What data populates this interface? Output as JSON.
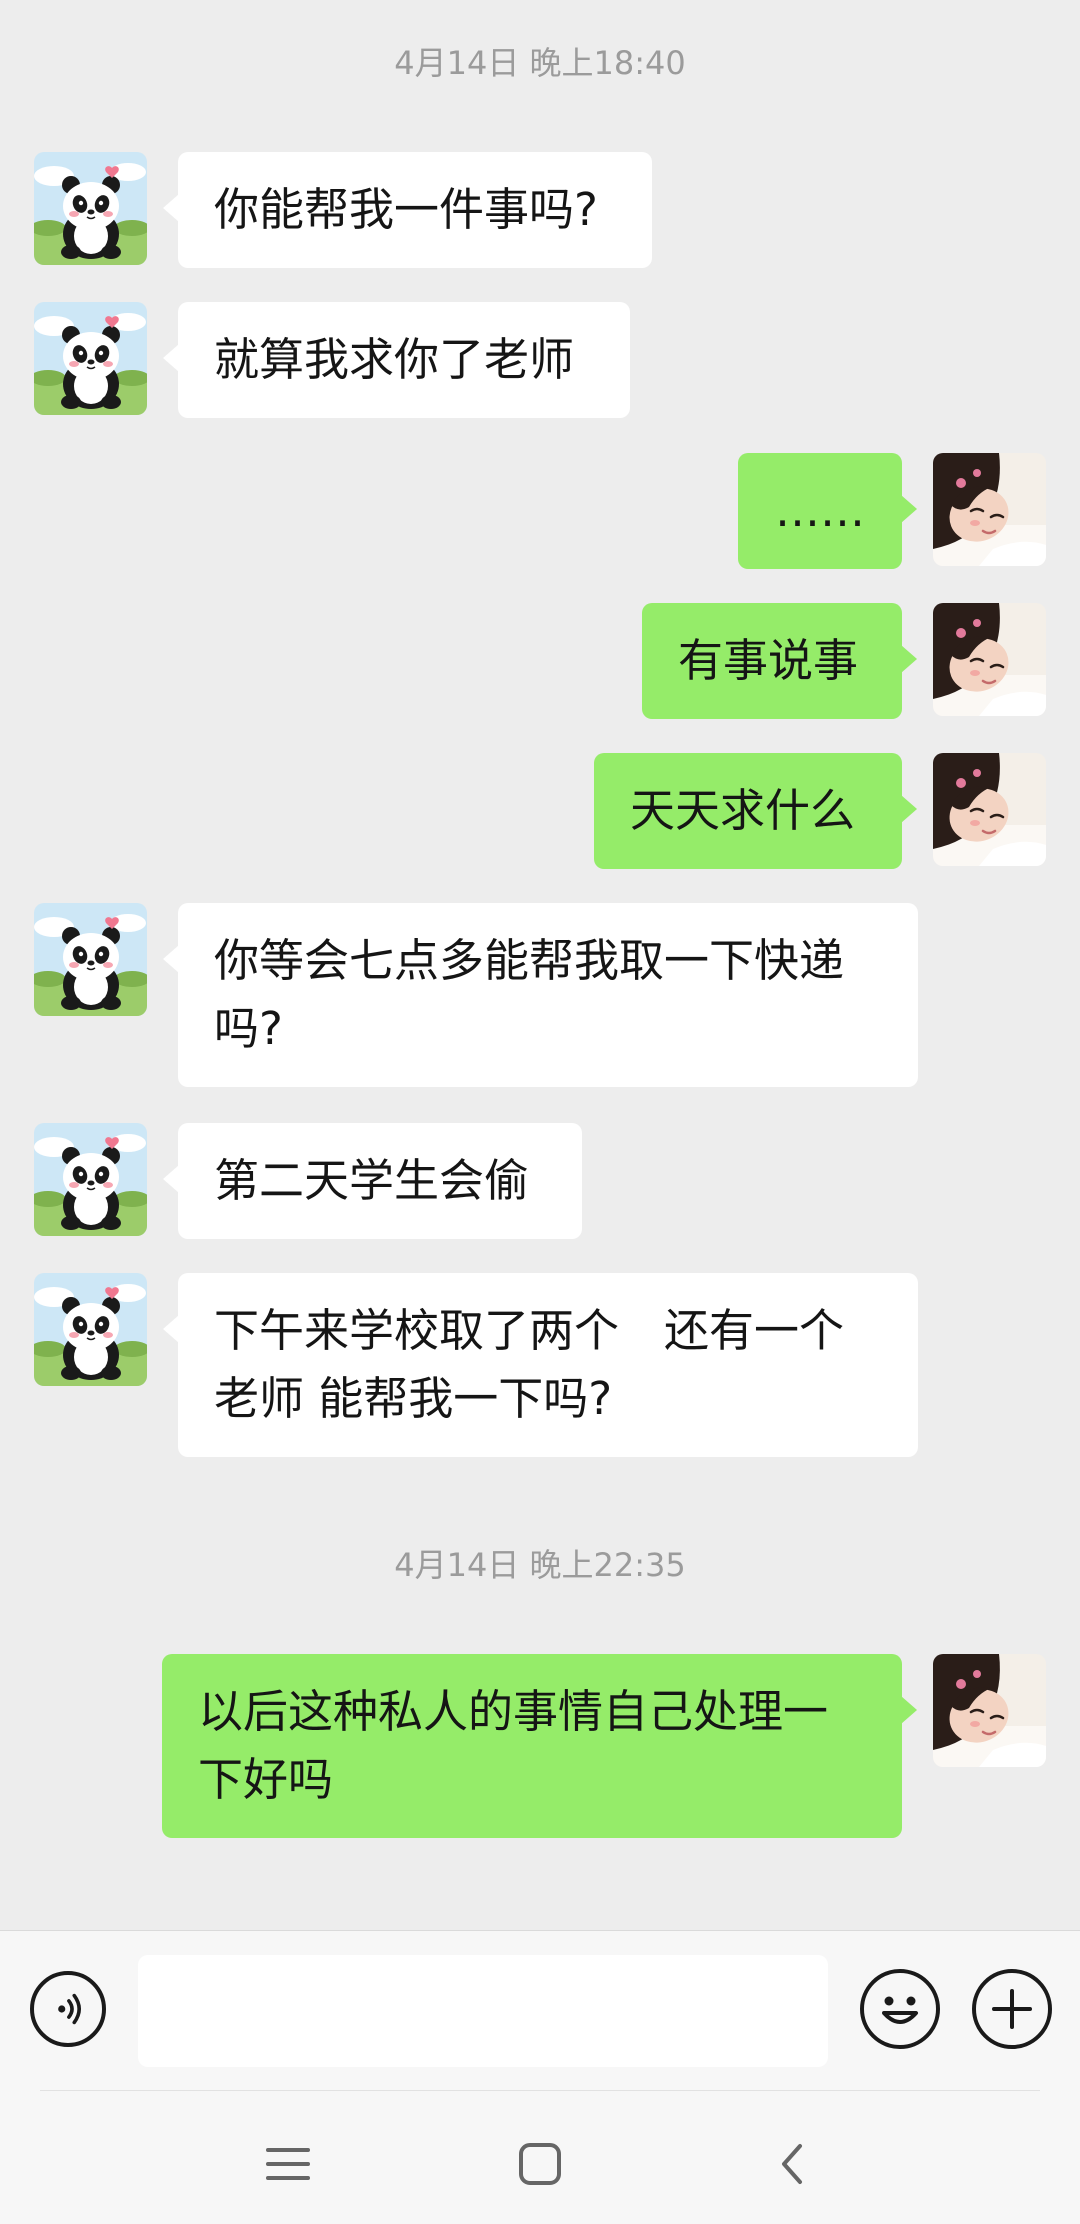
{
  "chat": {
    "timestamps": [
      "4月14日 晚上18:40",
      "4月14日 晚上22:35"
    ],
    "messages": [
      {
        "side": "left",
        "avatar": "panda-avatar",
        "text": "你能帮我一件事吗?"
      },
      {
        "side": "left",
        "avatar": "panda-avatar",
        "text": "就算我求你了老师"
      },
      {
        "side": "right",
        "avatar": "girl-avatar",
        "text": "……"
      },
      {
        "side": "right",
        "avatar": "girl-avatar",
        "text": "有事说事"
      },
      {
        "side": "right",
        "avatar": "girl-avatar",
        "text": "天天求什么"
      },
      {
        "side": "left",
        "avatar": "panda-avatar",
        "text": "你等会七点多能帮我取一下快递吗?"
      },
      {
        "side": "left",
        "avatar": "panda-avatar",
        "text": "第二天学生会偷"
      },
      {
        "side": "left",
        "avatar": "panda-avatar",
        "text": "下午来学校取了两个　还有一个老师 能帮我一下吗?"
      },
      {
        "side": "right",
        "avatar": "girl-avatar",
        "text": "以后这种私人的事情自己处理一下好吗"
      }
    ]
  },
  "input_bar": {
    "voice_icon": "voice-icon",
    "input_value": "",
    "emoji_icon": "emoji-icon",
    "plus_icon": "plus-icon"
  },
  "nav": {
    "menu_icon": "menu-icon",
    "home_icon": "home-icon",
    "back_icon": "back-icon"
  },
  "colors": {
    "background": "#ededed",
    "left_bubble": "#ffffff",
    "right_bubble": "#95ec69",
    "timestamp": "#9b9b9b"
  }
}
